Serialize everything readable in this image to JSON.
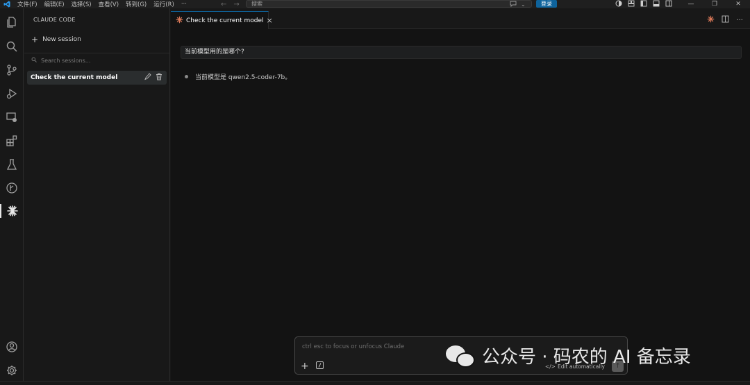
{
  "titlebar": {
    "menus": [
      "文件(F)",
      "编辑(E)",
      "选择(S)",
      "查看(V)",
      "转到(G)",
      "运行(R)",
      "···"
    ],
    "search_placeholder": "搜索",
    "login_label": "登录",
    "accent_color": "#0e639c"
  },
  "activitybar": {
    "icons": [
      "explorer-icon",
      "search-icon",
      "source-control-icon",
      "run-debug-icon",
      "remote-explorer-icon",
      "extensions-icon",
      "testing-icon",
      "gitlens-icon",
      "claude-icon",
      "account-icon",
      "settings-gear-icon"
    ]
  },
  "sidebar": {
    "title": "CLAUDE CODE",
    "new_session_label": "New session",
    "search_placeholder": "Search sessions...",
    "sessions": [
      {
        "label": "Check the current model"
      }
    ]
  },
  "editor": {
    "tab_label": "Check the current model",
    "user_message": "当前模型用的是哪个?",
    "reply_text": "当前模型是 qwen2.5-coder-7b。",
    "composer": {
      "placeholder": "ctrl esc to focus or unfocus Claude",
      "mode_label": "Edit automatically"
    }
  },
  "watermark": {
    "text": "公众号 · 码农的 AI 备忘录"
  },
  "colors": {
    "claude_orange": "#d97757",
    "background": "#131313"
  }
}
